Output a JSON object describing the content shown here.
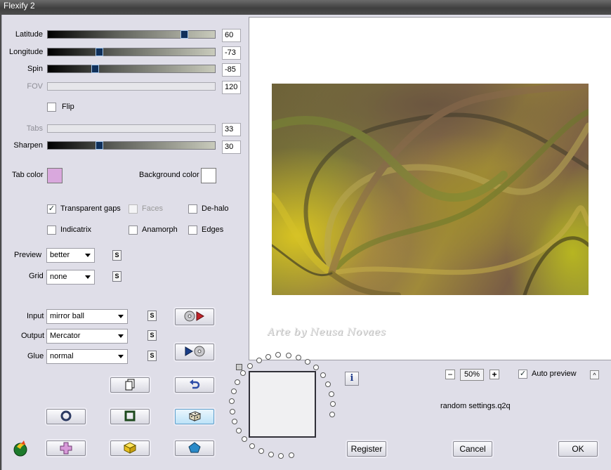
{
  "window": {
    "title": "Flexify 2"
  },
  "sliders": [
    {
      "label": "Latitude",
      "value": "60",
      "enabled": true,
      "fraction": 0.83
    },
    {
      "label": "Longitude",
      "value": "-73",
      "enabled": true,
      "fraction": 0.3
    },
    {
      "label": "Spin",
      "value": "-85",
      "enabled": true,
      "fraction": 0.27
    },
    {
      "label": "FOV",
      "value": "120",
      "enabled": false
    },
    {
      "label": "Tabs",
      "value": "33",
      "enabled": false
    },
    {
      "label": "Sharpen",
      "value": "30",
      "enabled": true,
      "fraction": 0.3
    }
  ],
  "flip": {
    "label": "Flip",
    "checked": false
  },
  "colors": {
    "tab_color_label": "Tab color",
    "tab_color": "#d9a8dd",
    "background_color_label": "Background color",
    "background_color": "#ffffff"
  },
  "options": {
    "transparent_gaps": {
      "label": "Transparent gaps",
      "checked": true
    },
    "faces": {
      "label": "Faces",
      "checked": false,
      "enabled": false
    },
    "de_halo": {
      "label": "De-halo",
      "checked": false
    },
    "indicatrix": {
      "label": "Indicatrix",
      "checked": false
    },
    "anamorph": {
      "label": "Anamorph",
      "checked": false
    },
    "edges": {
      "label": "Edges",
      "checked": false
    }
  },
  "dropdowns": {
    "preview": {
      "label": "Preview",
      "value": "better"
    },
    "grid": {
      "label": "Grid",
      "value": "none"
    },
    "input": {
      "label": "Input",
      "value": "mirror ball"
    },
    "output": {
      "label": "Output",
      "value": "Mercator"
    },
    "glue": {
      "label": "Glue",
      "value": "normal"
    }
  },
  "small_buttons": {
    "s_label": "S"
  },
  "preview_area": {
    "watermark": "Arte by Neusa Novaes"
  },
  "zoom": {
    "value": "50%",
    "minus": "−",
    "plus": "+"
  },
  "auto_preview": {
    "label": "Auto preview",
    "checked": true,
    "collapse": "^"
  },
  "settings_file": "random settings.q2q",
  "info_button": "i",
  "buttons": {
    "register": "Register",
    "cancel": "Cancel",
    "ok": "OK"
  },
  "icons": [
    "copy-icon",
    "undo-icon",
    "circle-shape-icon",
    "square-shape-icon",
    "dice-icon",
    "plus-shape-icon",
    "box-3d-icon",
    "pentagon-icon",
    "app-logo-icon",
    "disc-record-icon",
    "disc-play-icon"
  ]
}
